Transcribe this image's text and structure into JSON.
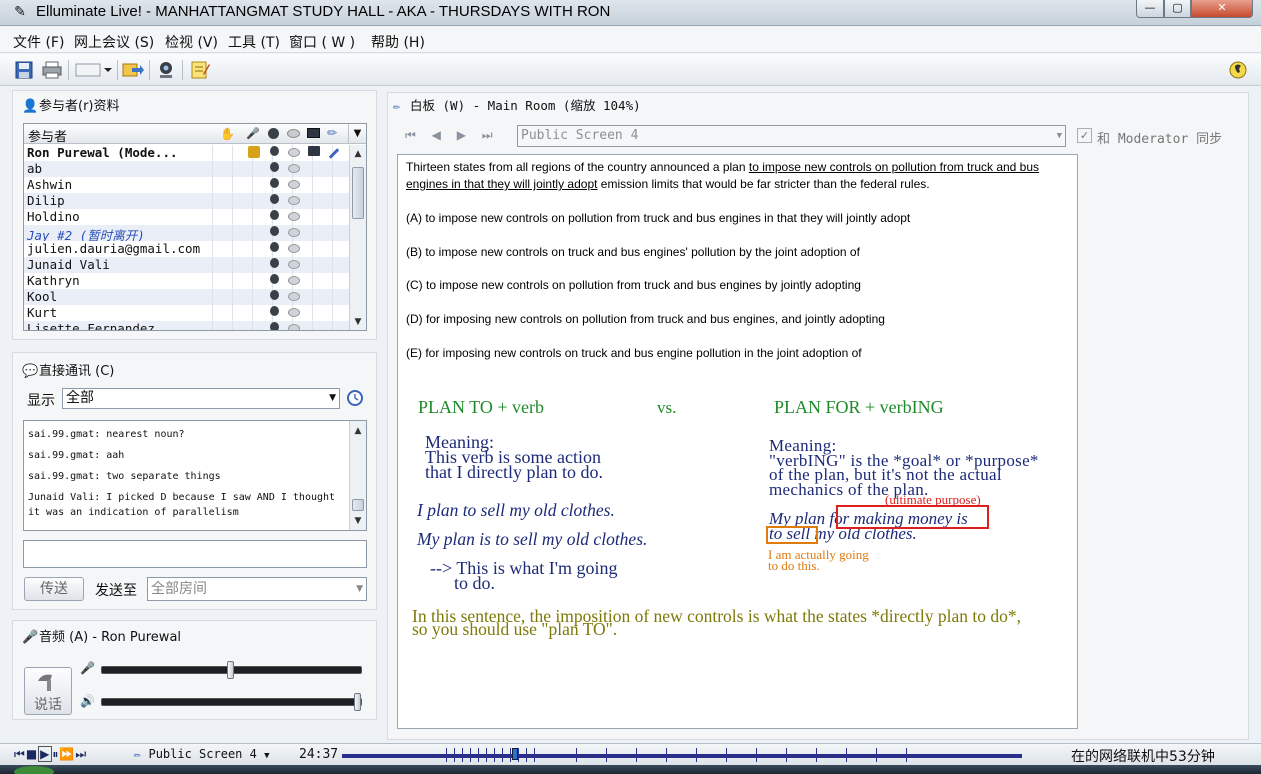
{
  "window": {
    "title": "Elluminate Live! - MANHATTANGMAT STUDY HALL - AKA - THURSDAYS WITH RON"
  },
  "menu": [
    "文件 (F)",
    "网上会议 (S)",
    "检视 (V)",
    "工具 (T)",
    "窗口 ( W )",
    "帮助 (H)"
  ],
  "participants": {
    "title": "参与者(r)资料",
    "column_header": "参与者",
    "rows": [
      {
        "name": "Ron Purewal (Mode..."
      },
      {
        "name": "ab"
      },
      {
        "name": "Ashwin"
      },
      {
        "name": "Dilip"
      },
      {
        "name": "Holdino"
      },
      {
        "name": "Jay #2 (暂时离开)"
      },
      {
        "name": "julien.dauria@gmail.com"
      },
      {
        "name": "Junaid Vali"
      },
      {
        "name": "Kathryn"
      },
      {
        "name": "Kool"
      },
      {
        "name": "Kurt"
      },
      {
        "name": "Lisette Fernandez"
      }
    ]
  },
  "direct_comm": {
    "title": "直接通讯 (C)",
    "show_label": "显示",
    "show_value": "全部",
    "messages": [
      "sai.99.gmat: nearest noun?",
      "sai.99.gmat: aah",
      "sai.99.gmat: two separate things",
      "Junaid Vali: I picked D because I saw AND I thought it was an indication of parallelism"
    ],
    "send_label": "传送",
    "send_to_label": "发送至",
    "send_to_value": "全部房间"
  },
  "audio": {
    "title": "音频 (A) - Ron Purewal",
    "talk_label": "说话",
    "mic_level": 0.5,
    "speaker_level": 1.0
  },
  "whiteboard": {
    "title": "白板 (W) - Main Room (缩放 104%)",
    "screen_select": "Public Screen 4",
    "sync_label": "和 Moderator 同步",
    "question_lines": [
      "Thirteen states from all regions of the country announced a plan ",
      "to impose new controls on pollution from truck and bus",
      "engines in that they will jointly adopt",
      " emission limits that would be far stricter than the federal rules."
    ],
    "options": [
      "(A) to impose new controls on pollution from truck and bus engines in that they will jointly adopt",
      "(B) to impose new controls on truck and bus engines' pollution by the joint adoption of",
      "(C) to impose new controls on pollution from truck and bus engines by jointly adopting",
      "(D) for imposing new controls on pollution from truck and bus engines, and jointly adopting",
      "(E) for imposing new controls on truck and bus engine pollution in the joint adoption of"
    ],
    "notes": {
      "left_head": "PLAN TO + verb",
      "vs": "vs.",
      "right_head": "PLAN FOR + verbING",
      "left_meaning": [
        "Meaning:",
        "This verb is some action",
        "that I directly plan to do."
      ],
      "left_ex1": "I plan to sell my old clothes.",
      "left_ex2": "My plan is to sell my old clothes.",
      "left_arrow": [
        "--> This is what I'm going",
        "to do."
      ],
      "right_meaning": [
        "Meaning:",
        "\"verbING\" is the *goal* or *purpose*",
        "of the plan, but it's not the actual",
        "mechanics of the plan."
      ],
      "ultimate": "(ultimate purpose)",
      "right_ex": [
        "My plan for making money is",
        "to sell my old clothes."
      ],
      "going": [
        "I am actually going",
        "to do this."
      ],
      "conclusion": [
        "In this sentence, the imposition of new controls is what the states *directly plan to do*,",
        "so you should use \"plan TO\"."
      ]
    }
  },
  "status": {
    "screen": "Public Screen 4",
    "time": "24:37",
    "online": "在的网络联机中53分钟"
  },
  "colors": {
    "green": "#1f8a2a",
    "navy": "#1d2a78",
    "olive": "#7d7a07",
    "orange": "#e07b10",
    "red": "#dd1f1f"
  }
}
